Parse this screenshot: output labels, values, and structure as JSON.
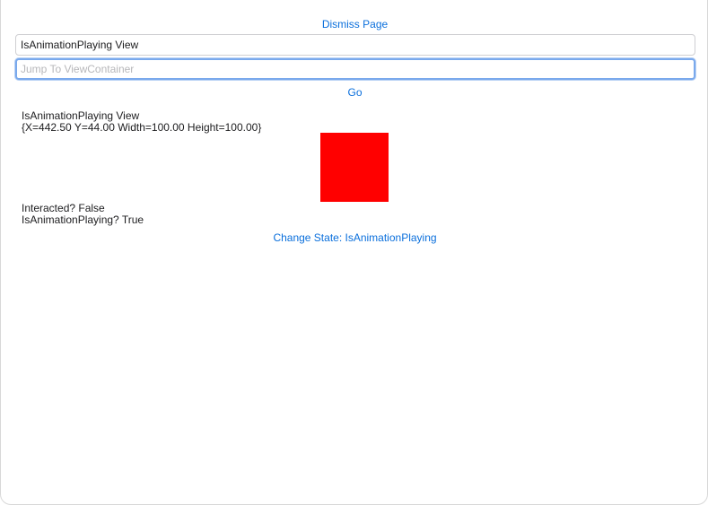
{
  "header": {
    "dismiss_label": "Dismiss Page"
  },
  "title_field": {
    "value": "IsAnimationPlaying View"
  },
  "jump": {
    "value": "",
    "placeholder": "Jump To ViewContainer",
    "go_label": "Go"
  },
  "content": {
    "view_name": "IsAnimationPlaying View",
    "bounds": "{X=442.50 Y=44.00 Width=100.00 Height=100.00}",
    "box_color": "#ff0000",
    "interacted": "Interacted? False",
    "animation_playing": "IsAnimationPlaying? True",
    "change_state_label": "Change State: IsAnimationPlaying"
  },
  "colors": {
    "accent": "#0a6fdc",
    "focus_ring": "#7aa9ec"
  }
}
